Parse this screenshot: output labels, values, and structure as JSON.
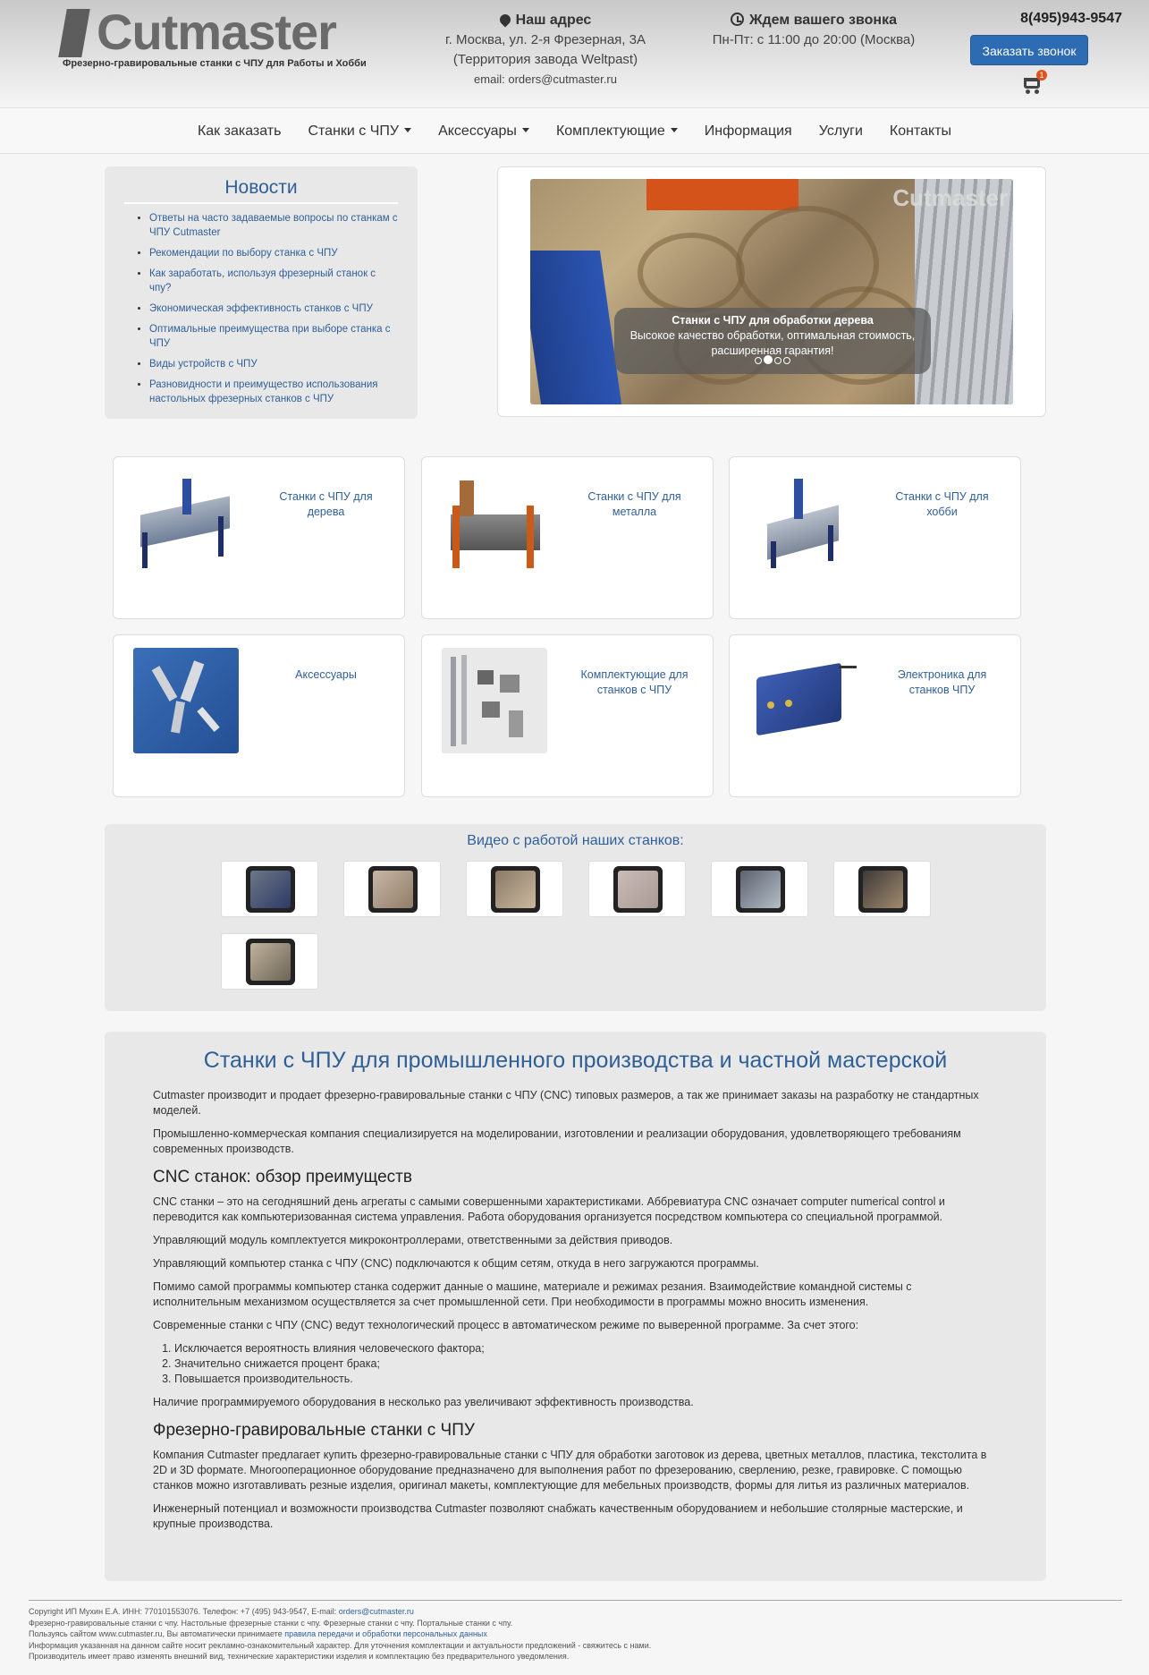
{
  "header": {
    "logo_text": "Cutmaster",
    "tagline": "Фрезерно-гравировальные станки с ЧПУ для Работы и Хобби",
    "address": {
      "title": "Наш адрес",
      "line1": "г. Москва, ул. 2-я Фрезерная, 3А",
      "line2": "(Территория завода Weltpast)",
      "email_label": "email:",
      "email": "orders@cutmaster.ru"
    },
    "callback": {
      "title": "Ждем вашего звонка",
      "hours": "Пн-Пт: с 11:00 до 20:00 (Москва)"
    },
    "phone": "8(495)943-9547",
    "order_button": "Заказать звонок",
    "cart_count": "1"
  },
  "nav": [
    {
      "label": "Как заказать",
      "dropdown": false
    },
    {
      "label": "Станки с ЧПУ",
      "dropdown": true
    },
    {
      "label": "Аксессуары",
      "dropdown": true
    },
    {
      "label": "Комплектующие",
      "dropdown": true
    },
    {
      "label": "Информация",
      "dropdown": false
    },
    {
      "label": "Услуги",
      "dropdown": false
    },
    {
      "label": "Контакты",
      "dropdown": false
    }
  ],
  "news": {
    "title": "Новости",
    "items": [
      "Ответы на часто задаваемые вопросы по станкам с ЧПУ Cutmaster",
      "Рекомендации по выбору станка с ЧПУ",
      "Как заработать, используя фрезерный станок с чпу?",
      "Экономическая эффективность станков с ЧПУ",
      "Оптимальные преимущества при выборе станка с ЧПУ",
      "Виды устройств с ЧПУ",
      "Разновидности и преимущество использования настольных фрезерных станков с ЧПУ"
    ]
  },
  "slider": {
    "watermark": "Cutmaster",
    "caption_title": "Станки с ЧПУ для обработки дерева",
    "caption_text": "Высокое качество обработки, оптимальная стоимость, расширенная гарантия!",
    "slide_count": 4,
    "active_slide": 2
  },
  "categories": [
    {
      "label": "Станки с ЧПУ для дерева"
    },
    {
      "label": "Станки с ЧПУ для металла"
    },
    {
      "label": "Станки с ЧПУ для хобби"
    },
    {
      "label": "Аксессуары"
    },
    {
      "label": "Комплектующие для станков с ЧПУ"
    },
    {
      "label": "Электроника для станков ЧПУ"
    }
  ],
  "videos": {
    "title": "Видео с работой наших станков:",
    "count": 7
  },
  "about": {
    "title": "Станки с ЧПУ для промышленного производства и частной мастерской",
    "p1": "Cutmaster производит и продает фрезерно-гравировальные станки с ЧПУ (CNC) типовых размеров, а так же принимает заказы на разработку не стандартных моделей.",
    "p2": "Промышленно-коммерческая компания специализируется на моделировании, изготовлении и реализации оборудования, удовлетворяющего требованиям современных производств.",
    "h2a": "CNC станок: обзор преимуществ",
    "p3": "CNC станки – это на сегодняшний день агрегаты с самыми совершенными характеристиками. Аббревиатура CNC означает computer numerical control и переводится как компьютеризованная система управления. Работа оборудования организуется посредством компьютера со специальной программой.",
    "p4": "Управляющий модуль комплектуется микроконтроллерами, ответственными за действия приводов.",
    "p5": "Управляющий компьютер станка с ЧПУ (CNC) подключаются к общим сетям, откуда в него загружаются программы.",
    "p6": "Помимо самой программы компьютер станка содержит данные о машине, материале и режимах резания. Взаимодействие командной системы с исполнительным механизмом осуществляется за счет промышленной сети. При необходимости в программы можно вносить изменения.",
    "p7": "Современные станки с ЧПУ (CNC) ведут технологический процесс в автоматическом режиме по выверенной программе. За счет этого:",
    "list": [
      "Исключается вероятность влияния человеческого фактора;",
      "Значительно снижается процент брака;",
      "Повышается производительность."
    ],
    "p8": "Наличие программируемого оборудования в несколько раз увеличивают эффективность производства.",
    "h2b": "Фрезерно-гравировальные станки с ЧПУ",
    "p9": "Компания Cutmaster предлагает купить фрезерно-гравировальные станки с ЧПУ для обработки заготовок из дерева, цветных металлов, пластика, текстолита в 2D и 3D формате. Многооперационное оборудование предназначено для выполнения работ по фрезерованию, сверлению, резке, гравировке. С помощью станков можно изготавливать резные изделия, оригинал макеты, комплектующие для мебельных производств, формы для литья из различных материалов.",
    "p10": "Инженерный потенциал и возможности производства Cutmaster позволяют снабжать качественным оборудованием и небольшие столярные мастерские, и крупные производства."
  },
  "footer": {
    "line1_text": "Copyright ИП Мухин Е.А. ИНН: 770101553076. Телефон: +7 (495) 943-9547, E-mail:",
    "line1_email": "orders@cutmaster.ru",
    "line2": "Фрезерно-гравировальные станки с чпу. Настольные фрезерные станки с чпу. Фрезерные станки с чпу. Портальные станки с чпу.",
    "line3_text": "Пользуясь сайтом www.cutmaster.ru, Вы автоматически принимаете",
    "line3_link": "правила передачи и обработки персональных данных",
    "line4": "Информация указанная на данном сайте носит рекламно-ознакомительный характер. Для уточнения комплектации и актуальности предложений - свяжитесь с нами.",
    "line5": "Производитель имеет право изменять внешний вид, технические характеристики изделия и комплектацию без предварительного уведомления."
  }
}
